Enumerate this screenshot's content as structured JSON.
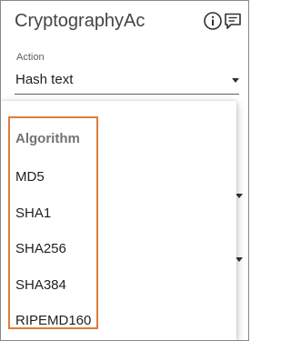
{
  "app": {
    "title": "CryptographyAc"
  },
  "header_icons": [
    {
      "name": "info-icon"
    },
    {
      "name": "feedback-icon"
    }
  ],
  "action": {
    "label": "Action",
    "value": "Hash text"
  },
  "dropdown": {
    "header": "Algorithm",
    "options": [
      "MD5",
      "SHA1",
      "SHA256",
      "SHA384",
      "RIPEMD160"
    ]
  },
  "colors": {
    "highlight_border": "#e07b3a",
    "text": "#201f1e",
    "group_header": "#737373"
  }
}
